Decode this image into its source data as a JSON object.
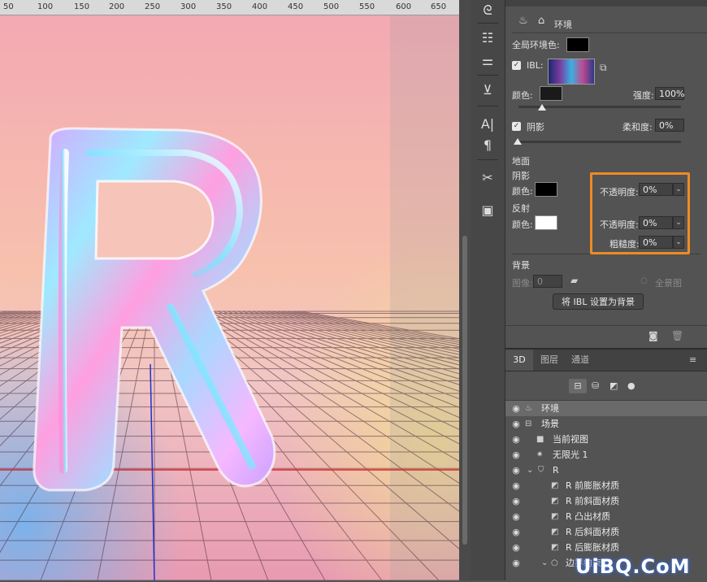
{
  "ruler": {
    "labels": [
      "50",
      "100",
      "150",
      "200",
      "250",
      "300",
      "350",
      "400",
      "450",
      "500",
      "550",
      "600",
      "650"
    ]
  },
  "canvas": {
    "letter": "R"
  },
  "tools": [
    "move-tool-icon",
    "properties-icon",
    "adjust-sliders-icon",
    "stamp-icon",
    "character-icon",
    "paragraph-icon",
    "tools-crossed-icon",
    "layer-comp-icon"
  ],
  "properties": {
    "env_tab_label": "环境",
    "global_ambient_label": "全局环境色:",
    "ibl_label": "IBL:",
    "color_label": "颜色:",
    "intensity_label": "强度:",
    "intensity_value": "100%",
    "shadow_label": "阴影",
    "softness_label": "柔和度:",
    "softness_value": "0%",
    "ground_label": "地面",
    "ground_shadow_label": "阴影",
    "ground_shadow_color_label": "颜色:",
    "opacity_label_1": "不透明度:",
    "opacity_value_1": "0%",
    "reflection_label": "反射",
    "reflection_color_label": "颜色:",
    "opacity_label_2": "不透明度:",
    "opacity_value_2": "0%",
    "roughness_label": "粗糙度:",
    "roughness_value": "0%",
    "background_label": "背景",
    "image_label": "图像:",
    "image_value": "0",
    "panorama_label": "全景图",
    "set_ibl_button": "将 IBL 设置为背景",
    "colors": {
      "ambient": "#000000",
      "ibl_color": "#1a1a1a",
      "ground_shadow": "#000000",
      "reflection": "#ffffff",
      "highlight": "#f08a24"
    }
  },
  "layers": {
    "tabs": [
      "3D",
      "图层",
      "通道"
    ],
    "rows": [
      {
        "label": "环境"
      },
      {
        "label": "场景"
      },
      {
        "label": "当前视图"
      },
      {
        "label": "无限光 1"
      },
      {
        "label": "R"
      },
      {
        "label": "R 前膨胀材质"
      },
      {
        "label": "R 前斜面材质"
      },
      {
        "label": "R 凸出材质"
      },
      {
        "label": "R 后斜面材质"
      },
      {
        "label": "R 后膨胀材质"
      },
      {
        "label": "边界约束"
      }
    ]
  },
  "watermark": "UiBQ.CoM"
}
